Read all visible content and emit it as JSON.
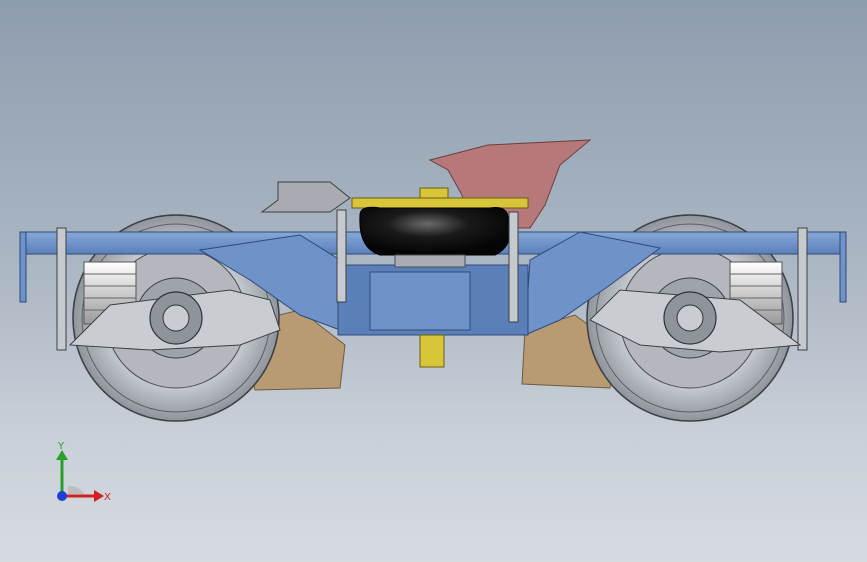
{
  "view": {
    "background_top": "#8e9dae",
    "background_bottom": "#d6dbe0"
  },
  "model": {
    "frame_color": "#6f93c9",
    "frame_dark": "#4d6fa6",
    "airspring_color": "#111111",
    "yellow_part_color": "#d9c53a",
    "bolster_color": "#b67878",
    "brake_pad_color": "#b89a73",
    "wheel_color": "#c9ccd1",
    "spring_color": "#e2e2e2"
  },
  "triad": {
    "y_label": "Y",
    "x_label": "X",
    "y_color": "#2aa02a",
    "x_color": "#d21f1f",
    "z_color": "#1f3fd2"
  }
}
